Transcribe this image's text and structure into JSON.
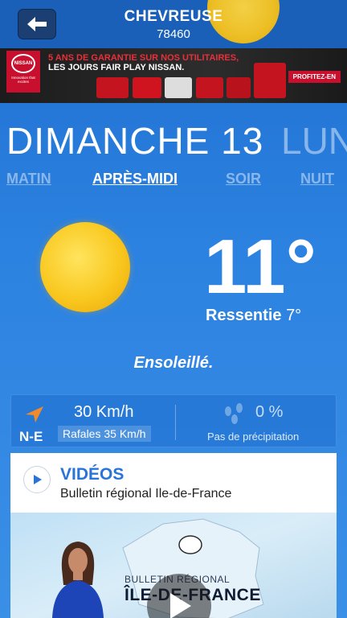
{
  "header": {
    "city": "CHEVREUSE",
    "postcode": "78460",
    "back_icon": "back-arrow-icon"
  },
  "ad": {
    "brand": "NISSAN",
    "tagline": "Innovation that excites",
    "line1": "5 ANS DE GARANTIE SUR NOS UTILITAIRES,",
    "line2": "LES JOURS FAIR PLAY NISSAN.",
    "cta": "PROFITEZ-EN"
  },
  "day": {
    "current": "DIMANCHE 13",
    "next": "LUN"
  },
  "periods": [
    {
      "label": "MATIN",
      "active": false
    },
    {
      "label": "APRÈS-MIDI",
      "active": true
    },
    {
      "label": "SOIR",
      "active": false
    },
    {
      "label": "NUIT",
      "active": false
    }
  ],
  "weather": {
    "temperature": "11°",
    "feels_label": "Ressentie",
    "feels_value": "7°",
    "condition": "Ensoleillé.",
    "icon": "sun-icon"
  },
  "wind": {
    "direction": "N-E",
    "speed": "30 Km/h",
    "gusts": "Rafales 35 Km/h",
    "icon": "wind-arrow-icon"
  },
  "precipitation": {
    "value": "0 %",
    "label": "Pas de précipitation",
    "icon": "raindrops-icon"
  },
  "videos": {
    "title": "VIDÉOS",
    "subtitle": "Bulletin régional Ile-de-France",
    "thumb_line1": "BULLETIN RÉGIONAL",
    "thumb_line2": "ÎLE-DE-FRANCE"
  },
  "colors": {
    "accent_blue": "#2a74d8",
    "background": "#2c82e0",
    "wind_arrow": "#f08a2a",
    "sun": "#f9c81f"
  }
}
